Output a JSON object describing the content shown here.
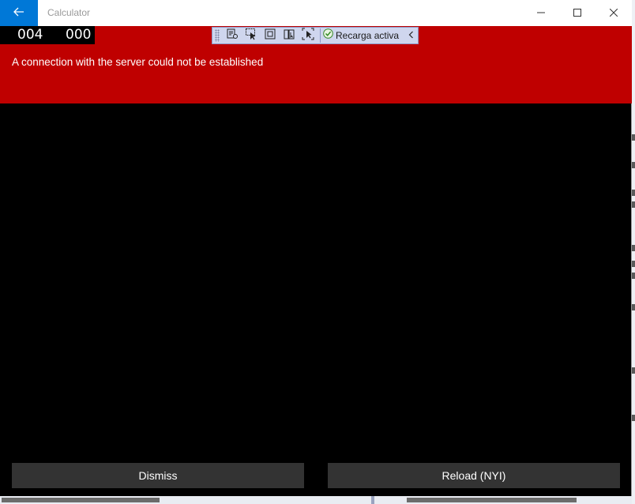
{
  "window": {
    "title": "Calculator",
    "back_icon": "arrow-left-icon",
    "controls": [
      "minimize-icon",
      "maximize-icon",
      "close-icon"
    ]
  },
  "frame_counter": {
    "left": "004",
    "right": "000"
  },
  "debug_toolbar": {
    "tools": [
      "live-visual-tree-icon",
      "select-element-icon",
      "display-layout-adorners-icon",
      "track-focus-icon",
      "preview-selection-icon"
    ],
    "hot_reload_label": "Recarga activa",
    "hot_reload_status": "check-circle-icon",
    "collapse_icon": "chevron-left-icon"
  },
  "error": {
    "message": "A connection with the server could not be established",
    "color": "#bf0000"
  },
  "buttons": {
    "dismiss": "Dismiss",
    "reload": "Reload (NYI)"
  },
  "theme": {
    "accent": "#0078d7",
    "background": "#000000",
    "button": "#333333"
  }
}
